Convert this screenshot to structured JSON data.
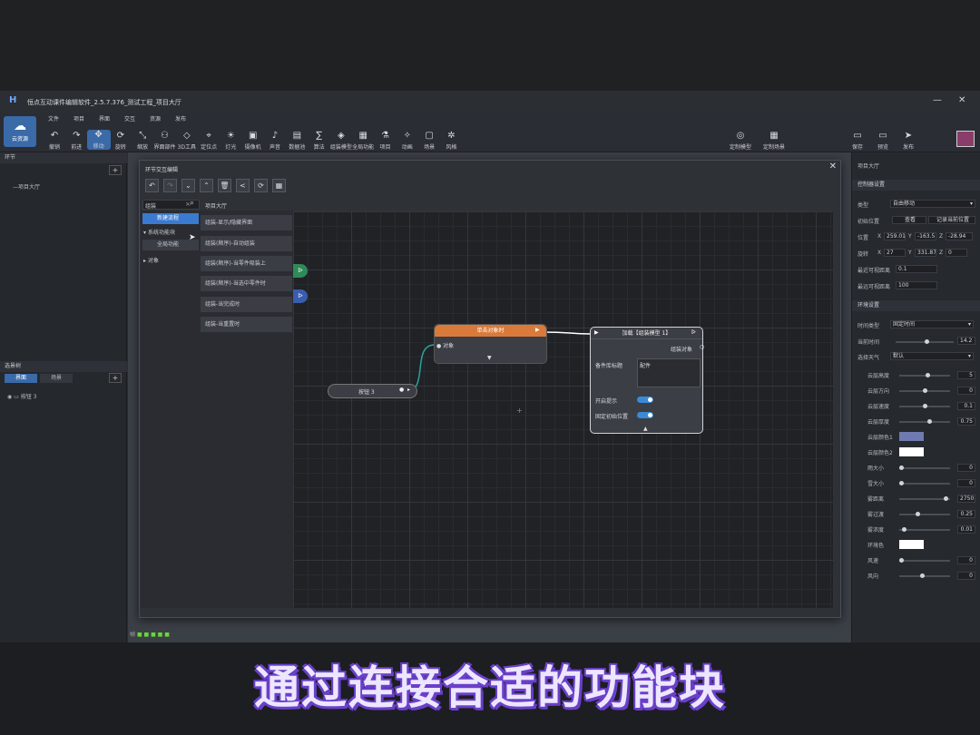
{
  "window": {
    "title": "恒点互动课件编辑软件_2.5.7.376_测试工程_项目大厅",
    "logo": "H",
    "minimize": "—",
    "close": "✕"
  },
  "menu": [
    "文件",
    "项目",
    "界面",
    "交互",
    "资源",
    "发布"
  ],
  "cloud_button": {
    "label": "云资源",
    "icon": "cloud-icon"
  },
  "toolbar": [
    {
      "label": "撤销",
      "icon": "↶"
    },
    {
      "label": "前进",
      "icon": "↷"
    },
    {
      "label": "移动",
      "icon": "✥"
    },
    {
      "label": "旋转",
      "icon": "⟳"
    },
    {
      "label": "缩放",
      "icon": "⤡"
    },
    {
      "label": "界面部件",
      "icon": "⚇"
    },
    {
      "label": "3D工具",
      "icon": "◇"
    },
    {
      "label": "定位点",
      "icon": "⌖"
    },
    {
      "label": "灯光",
      "icon": "☀"
    },
    {
      "label": "摄像机",
      "icon": "▣"
    },
    {
      "label": "声音",
      "icon": "♪"
    },
    {
      "label": "数据池",
      "icon": "▤"
    },
    {
      "label": "算法",
      "icon": "∑"
    },
    {
      "label": "组装模型",
      "icon": "◈"
    },
    {
      "label": "全局功能",
      "icon": "▦"
    },
    {
      "label": "项目",
      "icon": "⚗"
    },
    {
      "label": "动画",
      "icon": "✧"
    },
    {
      "label": "场景",
      "icon": "▢"
    },
    {
      "label": "风格",
      "icon": "✲"
    }
  ],
  "toolbar_right": [
    {
      "label": "定制模型",
      "icon": "◎"
    },
    {
      "label": "定制场景",
      "icon": "▦"
    },
    {
      "label": "保存",
      "icon": "▭"
    },
    {
      "label": "预览",
      "icon": "▭"
    },
    {
      "label": "发布",
      "icon": "➤"
    }
  ],
  "left_panel": {
    "section1_title": "环节",
    "tree_item": "项目大厅",
    "section2_title": "选景树",
    "tabs": [
      "界面",
      "场景"
    ],
    "scene_item": "按钮 3",
    "add": "+"
  },
  "dialog": {
    "title": "环节交互编辑",
    "close": "✕",
    "search_value": "组装",
    "search_clear": "×",
    "breadcrumb": "项目大厅",
    "tree": {
      "selected": "新建流程",
      "group": "系统功能块",
      "sub": "全局功能",
      "other": "对象"
    },
    "functions": [
      "组装-显示/隐藏界面",
      "组装(顺序)-自动组装",
      "组装(顺序)-当零件吸装上",
      "组装(顺序)-当选中零件时",
      "组装-当完成时",
      "组装-当重置时"
    ],
    "nodes": {
      "click_node": {
        "title": "单击对象时",
        "port": "对象"
      },
      "button_node": {
        "label": "按钮 3"
      },
      "load_node": {
        "title": "加载【组装模型 1】",
        "out_port": "组装对象",
        "field_label": "备件库标题",
        "field_value": "配件",
        "toggle1": "开启提示",
        "toggle2": "固定初始位置"
      }
    }
  },
  "right_panel": {
    "header": "项目大厅",
    "sections": {
      "camera": "控制器设置",
      "env": "环境设置"
    },
    "camera": {
      "type_label": "类型",
      "type_value": "自由移动",
      "init_label": "初始位置",
      "view_btn": "查看",
      "record_btn": "记录当前位置",
      "pos_label": "位置",
      "pos": [
        "X",
        "259.01",
        "Y",
        "-163.5",
        "Z",
        "-28.94"
      ],
      "rot_label": "旋转",
      "rot": [
        "X",
        "27",
        "Y",
        "331.87",
        "Z",
        "0"
      ],
      "min_dist_label": "最近可视距离",
      "min_dist": "0.1",
      "max_dist_label": "最远可视距离",
      "max_dist": "100"
    },
    "env": {
      "time_type_label": "时间类型",
      "time_type": "固定时间",
      "cur_time_label": "当前时间",
      "cur_time": "14.2",
      "weather_label": "选择天气",
      "weather": "默认",
      "sliders": [
        {
          "label": "云层高度",
          "value": "5",
          "level": 0.55
        },
        {
          "label": "云层方向",
          "value": "0",
          "level": 0.5
        },
        {
          "label": "云层速度",
          "value": "0.1",
          "level": 0.5
        },
        {
          "label": "云层厚度",
          "value": "0.75",
          "level": 0.6
        },
        {
          "label": "雨大小",
          "value": "0",
          "level": 0.0
        },
        {
          "label": "雪大小",
          "value": "0",
          "level": 0.0
        },
        {
          "label": "雾距离",
          "value": "2750",
          "level": 0.95
        },
        {
          "label": "雾过渡",
          "value": "0.25",
          "level": 0.35
        },
        {
          "label": "雾浓度",
          "value": "0.01",
          "level": 0.05
        },
        {
          "label": "风速",
          "value": "0",
          "level": 0.0
        },
        {
          "label": "风向",
          "value": "0",
          "level": 0.45
        }
      ],
      "cloud_color1_label": "云层颜色1",
      "cloud_color1": "#6f7bb0",
      "cloud_color2_label": "云层颜色2",
      "cloud_color2": "#ffffff",
      "ambient_label": "环境色",
      "ambient": "#ffffff"
    }
  },
  "status": {
    "label": "帧"
  },
  "subtitle": "通过连接合适的功能块",
  "colors": {
    "accent": "#3a6aa8",
    "node_orange": "#d97a3a",
    "teal": "#2aa39a",
    "toggle": "#3a8ad8"
  }
}
